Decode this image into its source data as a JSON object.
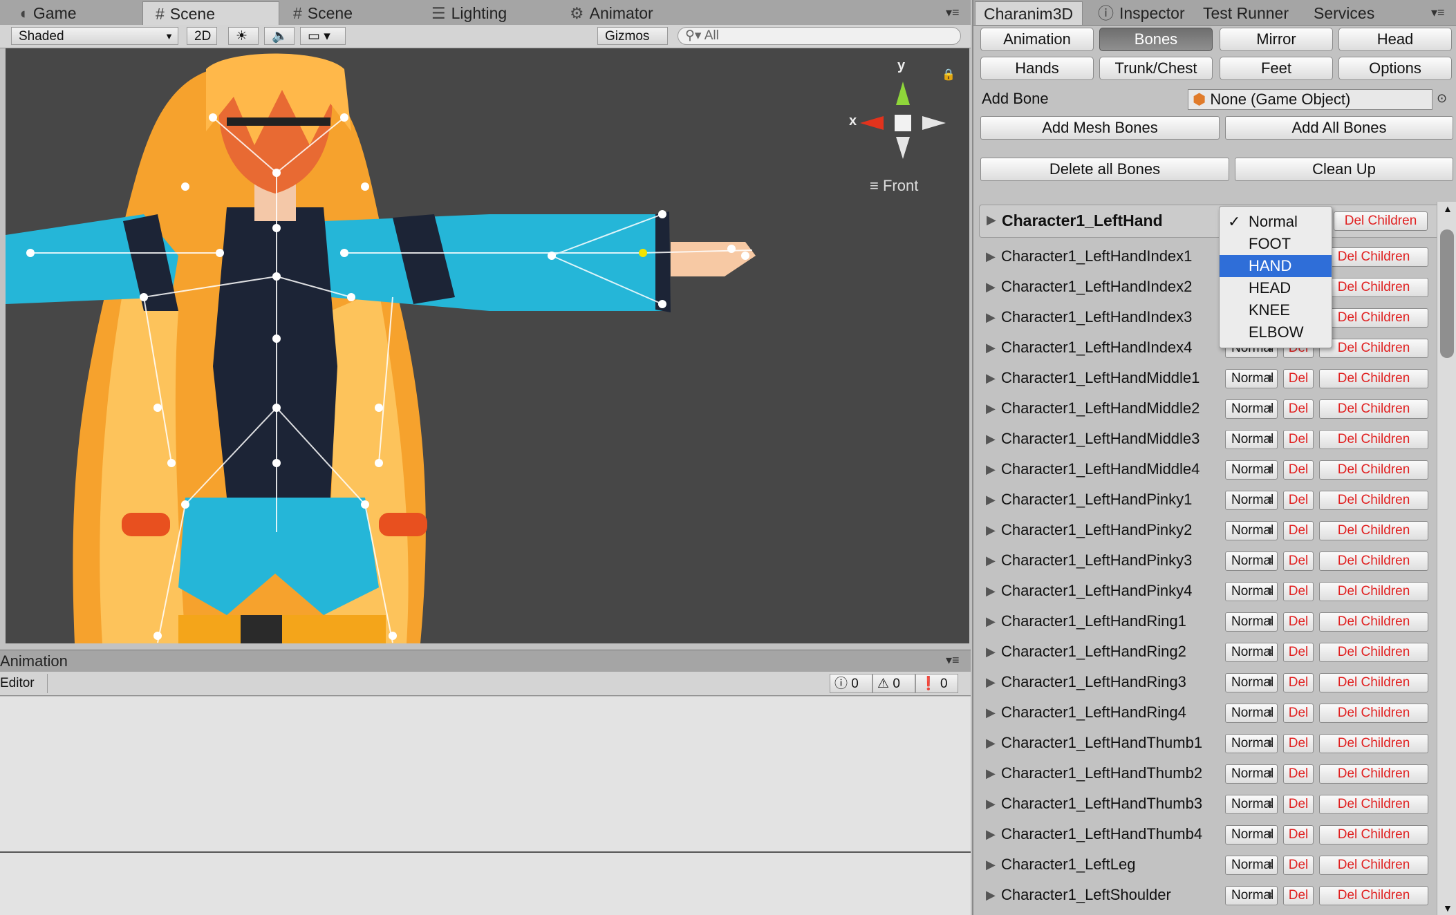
{
  "left_tabs": [
    {
      "label": "Game",
      "icon": "game-icon"
    },
    {
      "label": "Scene",
      "icon": "grid-icon"
    },
    {
      "label": "Scene",
      "icon": "grid-icon"
    },
    {
      "label": "Lighting",
      "icon": "lighting-icon"
    },
    {
      "label": "Animator",
      "icon": "animator-icon"
    }
  ],
  "scene_toolbar": {
    "shading_mode": "Shaded",
    "mode_2d": "2D",
    "gizmos": "Gizmos",
    "search_placeholder": "All"
  },
  "gizmo": {
    "y_label": "y",
    "x_label": "x",
    "view_label": "Front"
  },
  "animation_panel": {
    "title": "Animation",
    "editor_dropdown": "Editor",
    "info_count": "0",
    "warning_count": "0",
    "error_count": "0"
  },
  "right_tabs": [
    {
      "label": "Charanim3D"
    },
    {
      "label": "Inspector",
      "icon": "info-icon"
    },
    {
      "label": "Test Runner"
    },
    {
      "label": "Services"
    }
  ],
  "category_buttons": [
    "Animation",
    "Bones",
    "Mirror",
    "Head",
    "Hands",
    "Trunk/Chest",
    "Feet",
    "Options"
  ],
  "active_category": "Bones",
  "add_bone": {
    "label": "Add Bone",
    "value": "None (Game Object)"
  },
  "actions": {
    "add_mesh_bones": "Add Mesh Bones",
    "add_all_bones": "Add All Bones",
    "delete_all_bones": "Delete all Bones",
    "clean_up": "Clean Up"
  },
  "header_bone": {
    "name": "Character1_LeftHand",
    "del_children": "Del Children"
  },
  "type_dropdown": {
    "options": [
      "Normal",
      "FOOT",
      "HAND",
      "HEAD",
      "KNEE",
      "ELBOW"
    ],
    "checked": "Normal",
    "highlighted": "HAND"
  },
  "row_labels": {
    "type": "Normal",
    "del": "Del",
    "del_children": "Del Children"
  },
  "bones": [
    "Character1_LeftHandIndex1",
    "Character1_LeftHandIndex2",
    "Character1_LeftHandIndex3",
    "Character1_LeftHandIndex4",
    "Character1_LeftHandMiddle1",
    "Character1_LeftHandMiddle2",
    "Character1_LeftHandMiddle3",
    "Character1_LeftHandMiddle4",
    "Character1_LeftHandPinky1",
    "Character1_LeftHandPinky2",
    "Character1_LeftHandPinky3",
    "Character1_LeftHandPinky4",
    "Character1_LeftHandRing1",
    "Character1_LeftHandRing2",
    "Character1_LeftHandRing3",
    "Character1_LeftHandRing4",
    "Character1_LeftHandThumb1",
    "Character1_LeftHandThumb2",
    "Character1_LeftHandThumb3",
    "Character1_LeftHandThumb4",
    "Character1_LeftLeg",
    "Character1_LeftShoulder"
  ],
  "colors": {
    "accent_selected": "#2f6ed8",
    "delete_text": "#e02020",
    "viewport_bg": "#474747",
    "hair": "#f7a933",
    "outfit_cyan": "#25b6d8",
    "outfit_dark": "#1c2436"
  }
}
